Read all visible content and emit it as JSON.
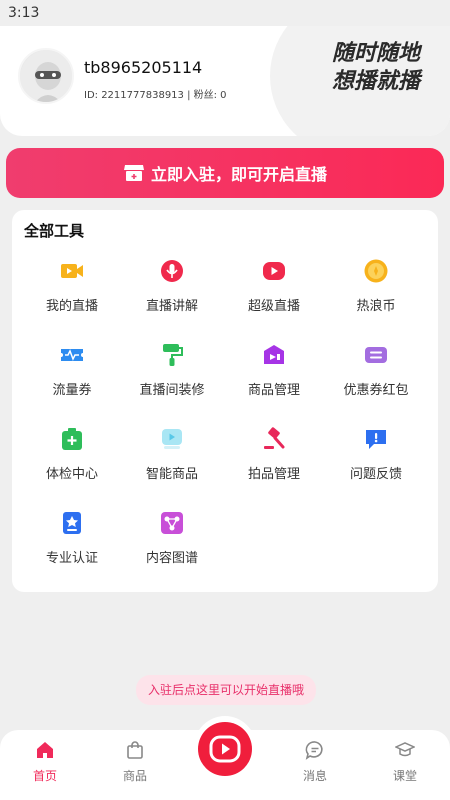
{
  "status_bar": {
    "time": "3:13"
  },
  "profile": {
    "username": "tb8965205114",
    "id_line": "ID: 2211777838913 | 粉丝: 0",
    "slogan_line1": "随时随地",
    "slogan_line2": "想播就播"
  },
  "cta": {
    "label": "立即入驻，即可开启直播",
    "icon": "store-icon"
  },
  "tools": {
    "title": "全部工具",
    "items": [
      {
        "label": "我的直播",
        "icon": "video-camera-icon",
        "color": "#f7b21b"
      },
      {
        "label": "直播讲解",
        "icon": "microphone-icon",
        "color": "#f0294c"
      },
      {
        "label": "超级直播",
        "icon": "play-icon",
        "color": "#f0294c"
      },
      {
        "label": "热浪币",
        "icon": "coin-icon",
        "color": "#f7b21b"
      },
      {
        "label": "流量券",
        "icon": "traffic-ticket-icon",
        "color": "#2d8cf0"
      },
      {
        "label": "直播间装修",
        "icon": "paint-roller-icon",
        "color": "#2ebd5a"
      },
      {
        "label": "商品管理",
        "icon": "product-manage-icon",
        "color": "#a634e6"
      },
      {
        "label": "优惠券红包",
        "icon": "coupon-icon",
        "color": "#a36de0"
      },
      {
        "label": "体检中心",
        "icon": "medical-kit-icon",
        "color": "#2ebd5a"
      },
      {
        "label": "智能商品",
        "icon": "smart-product-icon",
        "color": "#58c8e8"
      },
      {
        "label": "拍品管理",
        "icon": "auction-hammer-icon",
        "color": "#e8285a"
      },
      {
        "label": "问题反馈",
        "icon": "feedback-icon",
        "color": "#2d6ff0"
      },
      {
        "label": "专业认证",
        "icon": "certification-icon",
        "color": "#2d6ff0"
      },
      {
        "label": "内容图谱",
        "icon": "content-graph-icon",
        "color": "#c84fd8"
      }
    ]
  },
  "tip": {
    "text": "入驻后点这里可以开始直播哦"
  },
  "tabbar": {
    "tabs": [
      {
        "label": "首页",
        "icon": "home-icon",
        "active": true
      },
      {
        "label": "商品",
        "icon": "shopping-bag-icon",
        "active": false
      },
      {
        "label": "消息",
        "icon": "message-icon",
        "active": false
      },
      {
        "label": "课堂",
        "icon": "graduation-cap-icon",
        "active": false
      }
    ],
    "center_icon": "live-play-icon"
  },
  "colors": {
    "brand": "#f02a5a",
    "background": "#efefef"
  }
}
